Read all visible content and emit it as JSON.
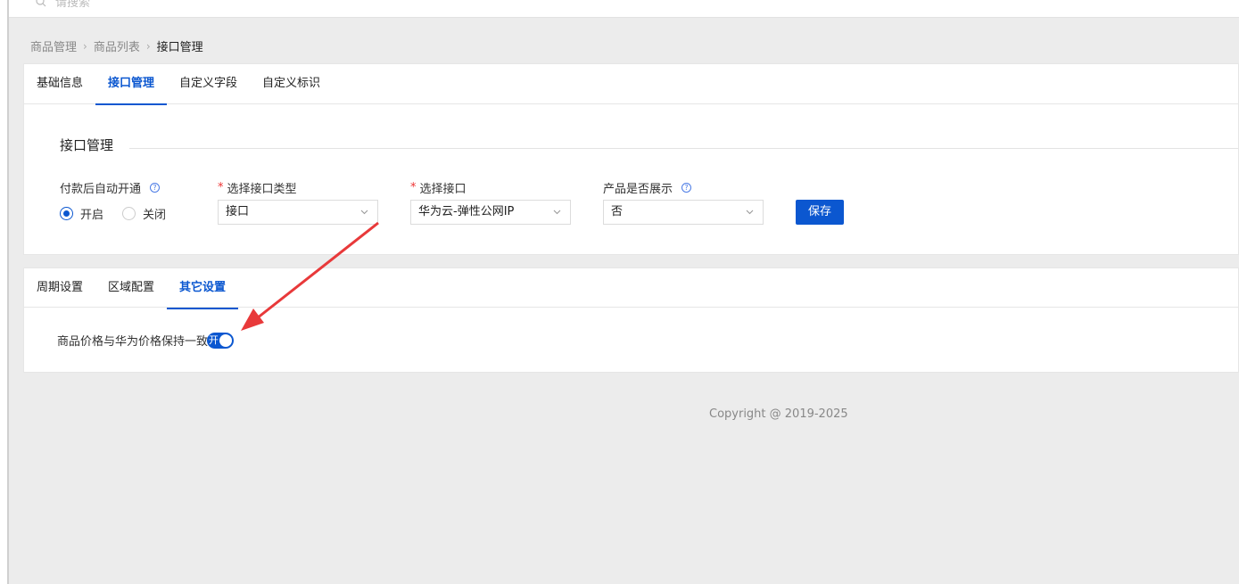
{
  "search": {
    "placeholder": "请搜索"
  },
  "breadcrumb": {
    "items": [
      "商品管理",
      "商品列表",
      "接口管理"
    ],
    "separator": "›"
  },
  "top_tabs": [
    {
      "label": "基础信息",
      "active": false
    },
    {
      "label": "接口管理",
      "active": true
    },
    {
      "label": "自定义字段",
      "active": false
    },
    {
      "label": "自定义标识",
      "active": false
    }
  ],
  "interface": {
    "section_title": "接口管理",
    "auto_open": {
      "label": "付款后自动开通",
      "options": [
        "开启",
        "关闭"
      ],
      "selected": "开启"
    },
    "interface_type": {
      "label": "选择接口类型",
      "value": "接口"
    },
    "interface": {
      "label": "选择接口",
      "value": "华为云-弹性公网IP"
    },
    "show_product": {
      "label": "产品是否展示",
      "value": "否"
    },
    "save_label": "保存"
  },
  "bottom_tabs": [
    {
      "label": "周期设置",
      "active": false
    },
    {
      "label": "区域配置",
      "active": false
    },
    {
      "label": "其它设置",
      "active": true
    }
  ],
  "other": {
    "price_sync_label": "商品价格与华为价格保持一致",
    "price_sync_switch_text": "开",
    "price_sync_on": true
  },
  "footer": {
    "copyright": "Copyright @ 2019-2025"
  },
  "colors": {
    "primary": "#0b57d0",
    "annotation_arrow": "#e8393a",
    "background": "#ececec"
  },
  "icons": [
    "search-icon",
    "chevron-down-icon",
    "help-icon",
    "annotation-arrow"
  ]
}
